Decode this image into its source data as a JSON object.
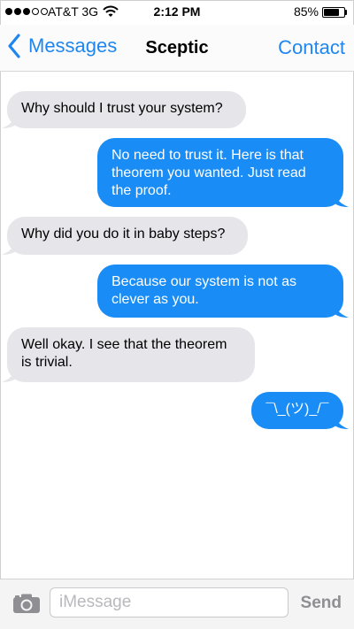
{
  "status_bar": {
    "carrier": "AT&T 3G",
    "time": "2:12 PM",
    "battery_percent": "85%",
    "signal_bars_filled": 3,
    "signal_bars_total": 5,
    "battery_level": 0.85
  },
  "nav": {
    "back_label": "Messages",
    "title": "Sceptic",
    "contact_label": "Contact"
  },
  "messages": [
    {
      "direction": "in",
      "text": "Why should I trust your system?"
    },
    {
      "direction": "out",
      "text": "No need to trust it. Here is that theorem you wanted. Just read the proof."
    },
    {
      "direction": "in",
      "text": "Why did you do it in baby steps?"
    },
    {
      "direction": "out",
      "text": "Because our system is not as clever as you."
    },
    {
      "direction": "in",
      "text": "Well okay. I see that the theorem is trivial."
    },
    {
      "direction": "out",
      "text": "¯\\_(ツ)_/¯"
    }
  ],
  "input_bar": {
    "placeholder": "iMessage",
    "value": "",
    "send_label": "Send",
    "camera_icon": "camera-icon"
  },
  "colors": {
    "accent": "#1f86f0",
    "outgoing_bubble": "#1a8cf5",
    "incoming_bubble": "#e5e5ea"
  }
}
